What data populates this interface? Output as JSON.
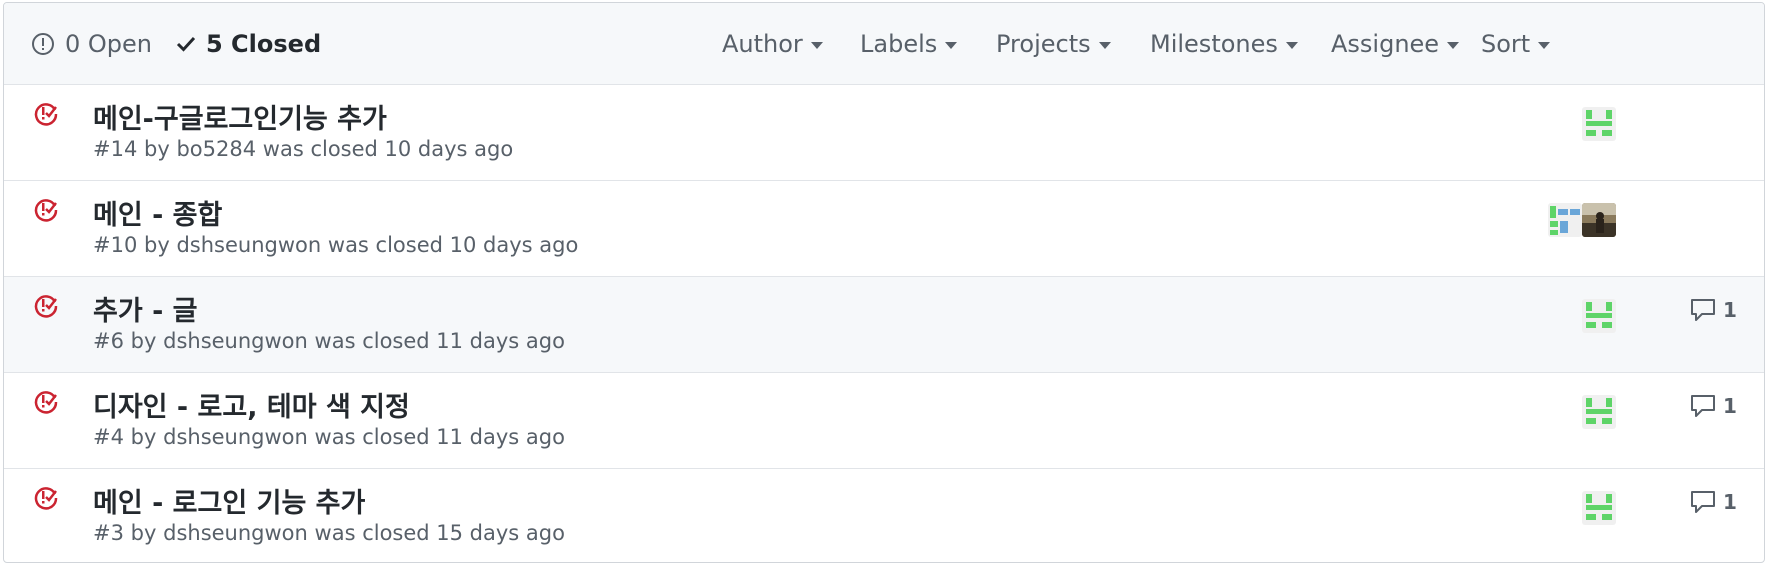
{
  "header": {
    "open_label": "0 Open",
    "closed_label": "5 Closed",
    "filters": {
      "author": "Author",
      "labels": "Labels",
      "projects": "Projects",
      "milestones": "Milestones",
      "assignee": "Assignee",
      "sort": "Sort"
    }
  },
  "colors": {
    "closed_icon": "#cb2431",
    "identicon_green": "#5ed468",
    "identicon_blue": "#6aa6d8"
  },
  "issues": [
    {
      "title": "메인-구글로그인기능 추가",
      "number": "#14",
      "by": "by",
      "author": "bo5284",
      "status": "was closed 10 days ago",
      "assignees": [
        "green-identicon"
      ],
      "comments": ""
    },
    {
      "title": "메인 - 종합",
      "number": "#10",
      "by": "by",
      "author": "dshseungwon",
      "status": "was closed 10 days ago",
      "assignees": [
        "blue-identicon",
        "photo-avatar"
      ],
      "comments": ""
    },
    {
      "title": "추가 - 글",
      "number": "#6",
      "by": "by",
      "author": "dshseungwon",
      "status": "was closed 11 days ago",
      "assignees": [
        "green-identicon"
      ],
      "comments": "1"
    },
    {
      "title": "디자인 - 로고, 테마 색 지정",
      "number": "#4",
      "by": "by",
      "author": "dshseungwon",
      "status": "was closed 11 days ago",
      "assignees": [
        "green-identicon"
      ],
      "comments": "1"
    },
    {
      "title": "메인 - 로그인 기능 추가",
      "number": "#3",
      "by": "by",
      "author": "dshseungwon",
      "status": "was closed 15 days ago",
      "assignees": [
        "green-identicon"
      ],
      "comments": "1"
    }
  ]
}
